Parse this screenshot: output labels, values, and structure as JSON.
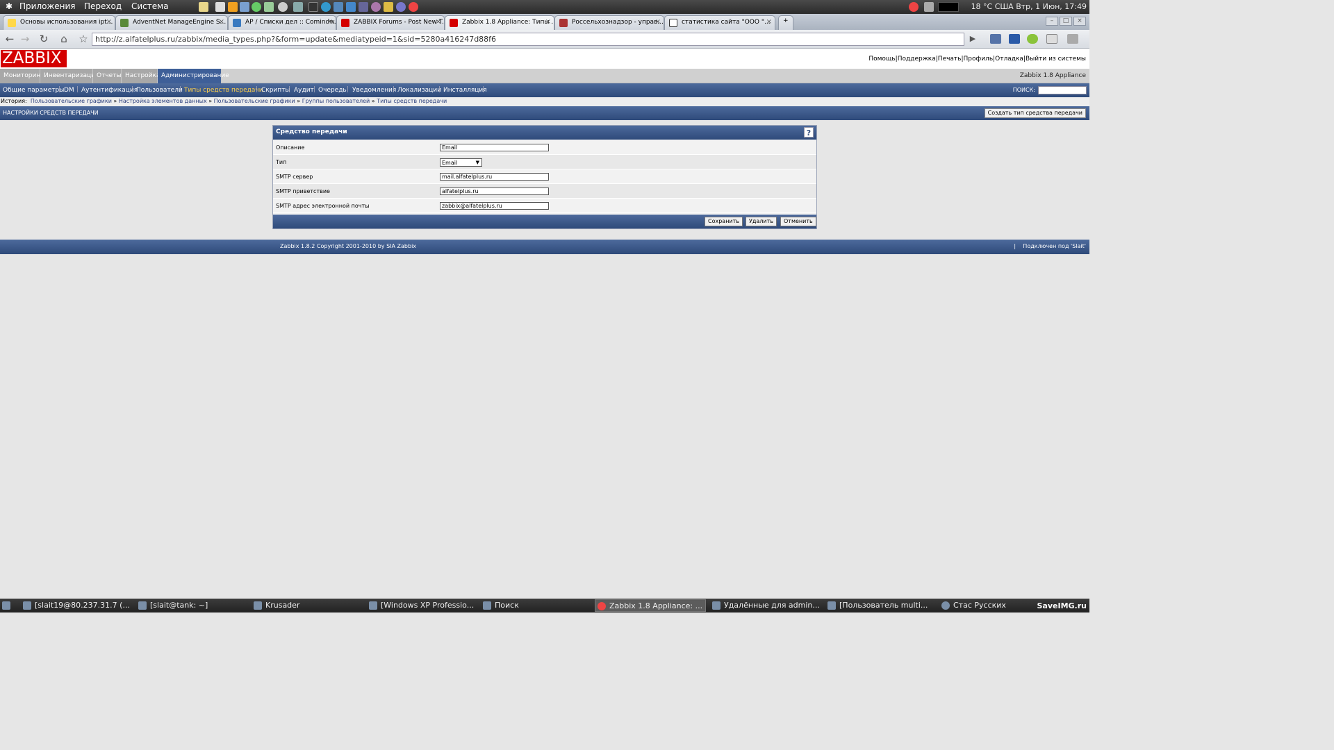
{
  "gnome": {
    "menus": [
      "Приложения",
      "Переход",
      "Система"
    ],
    "tray": "18 °C США  Втр, 1 Июн, 17:49"
  },
  "browser": {
    "tabs": [
      {
        "label": "Основы использования ipt..."
      },
      {
        "label": "AdventNet ManageEngine S..."
      },
      {
        "label": "AP / Списки дел :: Comindw..."
      },
      {
        "label": "ZABBIX Forums - Post New T..."
      },
      {
        "label": "Zabbix 1.8 Appliance: Типы ..."
      },
      {
        "label": "Россельхознадзор - управ..."
      },
      {
        "label": "статистика сайта \"ООО \"..."
      }
    ],
    "url": "http://z.alfatelplus.ru/zabbix/media_types.php?&form=update&mediatypeid=1&sid=5280a416247d88f6"
  },
  "zabbix": {
    "logo": "ZABBIX",
    "top_links": [
      "Помощь",
      "Поддержка",
      "Печать",
      "Профиль",
      "Отладка",
      "Выйти из системы"
    ],
    "appliance": "Zabbix 1.8 Appliance",
    "main_menu": [
      "Мониторинг",
      "Инвентаризация",
      "Отчеты",
      "Настройка",
      "Администрирование"
    ],
    "sub_menu": [
      "Общие параметры",
      "DM",
      "Аутентификация",
      "Пользователи",
      "Типы средств передачи",
      "Скрипты",
      "Аудит",
      "Очередь",
      "Уведомления",
      "Локализации",
      "Инсталляция"
    ],
    "search_label": "ПОИСК:",
    "history_label": "История:",
    "history": [
      "Пользовательские графики",
      "Настройка элементов данных",
      "Пользовательские графики",
      "Группы пользователей",
      "Типы средств передачи"
    ],
    "page_title": "НАСТРОЙКИ СРЕДСТВ ПЕРЕДАЧИ",
    "create_button": "Создать тип средства передачи",
    "form": {
      "title": "Средство передачи",
      "help": "?",
      "fields": [
        {
          "label": "Описание",
          "value": "Email"
        },
        {
          "label": "Тип",
          "value": "Email"
        },
        {
          "label": "SMTP сервер",
          "value": "mail.alfatelplus.ru"
        },
        {
          "label": "SMTP приветствие",
          "value": "alfatelplus.ru"
        },
        {
          "label": "SMTP адрес электронной почты",
          "value": "zabbix@alfatelplus.ru"
        }
      ],
      "buttons": {
        "save": "Сохранить",
        "delete": "Удалить",
        "cancel": "Отменить"
      }
    },
    "footer": {
      "copyright": "Zabbix 1.8.2 Copyright 2001-2010 by SIA Zabbix",
      "connected": "Подключен под 'Slait'"
    }
  },
  "taskbar": {
    "tasks": [
      "[slait19@80.237.31.7 (...",
      "[slait@tank: ~]",
      "Krusader",
      "[Windows XP Professio...",
      "Поиск",
      "Zabbix 1.8 Appliance: ...",
      "Удалённые для admin...",
      "[Пользователь multi...",
      "Стас Русских"
    ],
    "watermark": "SaveIMG.ru"
  }
}
